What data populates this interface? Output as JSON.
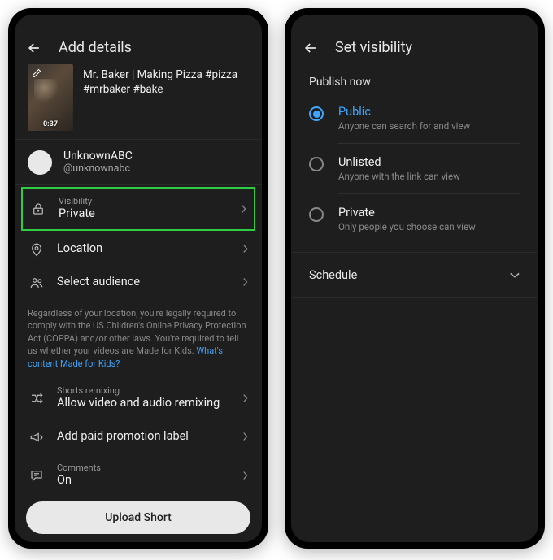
{
  "left": {
    "header_title": "Add details",
    "video_title": "Mr. Baker | Making Pizza #pizza #mrbaker #bake",
    "video_time": "0:37",
    "account_name": "UnknownABC",
    "account_handle": "@unknownabc",
    "rows": {
      "visibility_label": "Visibility",
      "visibility_value": "Private",
      "location": "Location",
      "audience": "Select audience",
      "remix_label": "Shorts remixing",
      "remix_value": "Allow video and audio remixing",
      "promotion": "Add paid promotion label",
      "comments_label": "Comments",
      "comments_value": "On"
    },
    "legal_text": "Regardless of your location, you're legally required to comply with the US Children's Online Privacy Protection Act (COPPA) and/or other laws. You're required to tell us whether your videos are Made for Kids. ",
    "legal_link": "What's content Made for Kids?",
    "upload_button": "Upload Short"
  },
  "right": {
    "header_title": "Set visibility",
    "publish_label": "Publish now",
    "options": [
      {
        "title": "Public",
        "desc": "Anyone can search for and view",
        "selected": true
      },
      {
        "title": "Unlisted",
        "desc": "Anyone with the link can view",
        "selected": false
      },
      {
        "title": "Private",
        "desc": "Only people you choose can view",
        "selected": false
      }
    ],
    "schedule_label": "Schedule"
  },
  "colors": {
    "accent": "#3ea6ff",
    "highlight": "#2ecc40"
  }
}
